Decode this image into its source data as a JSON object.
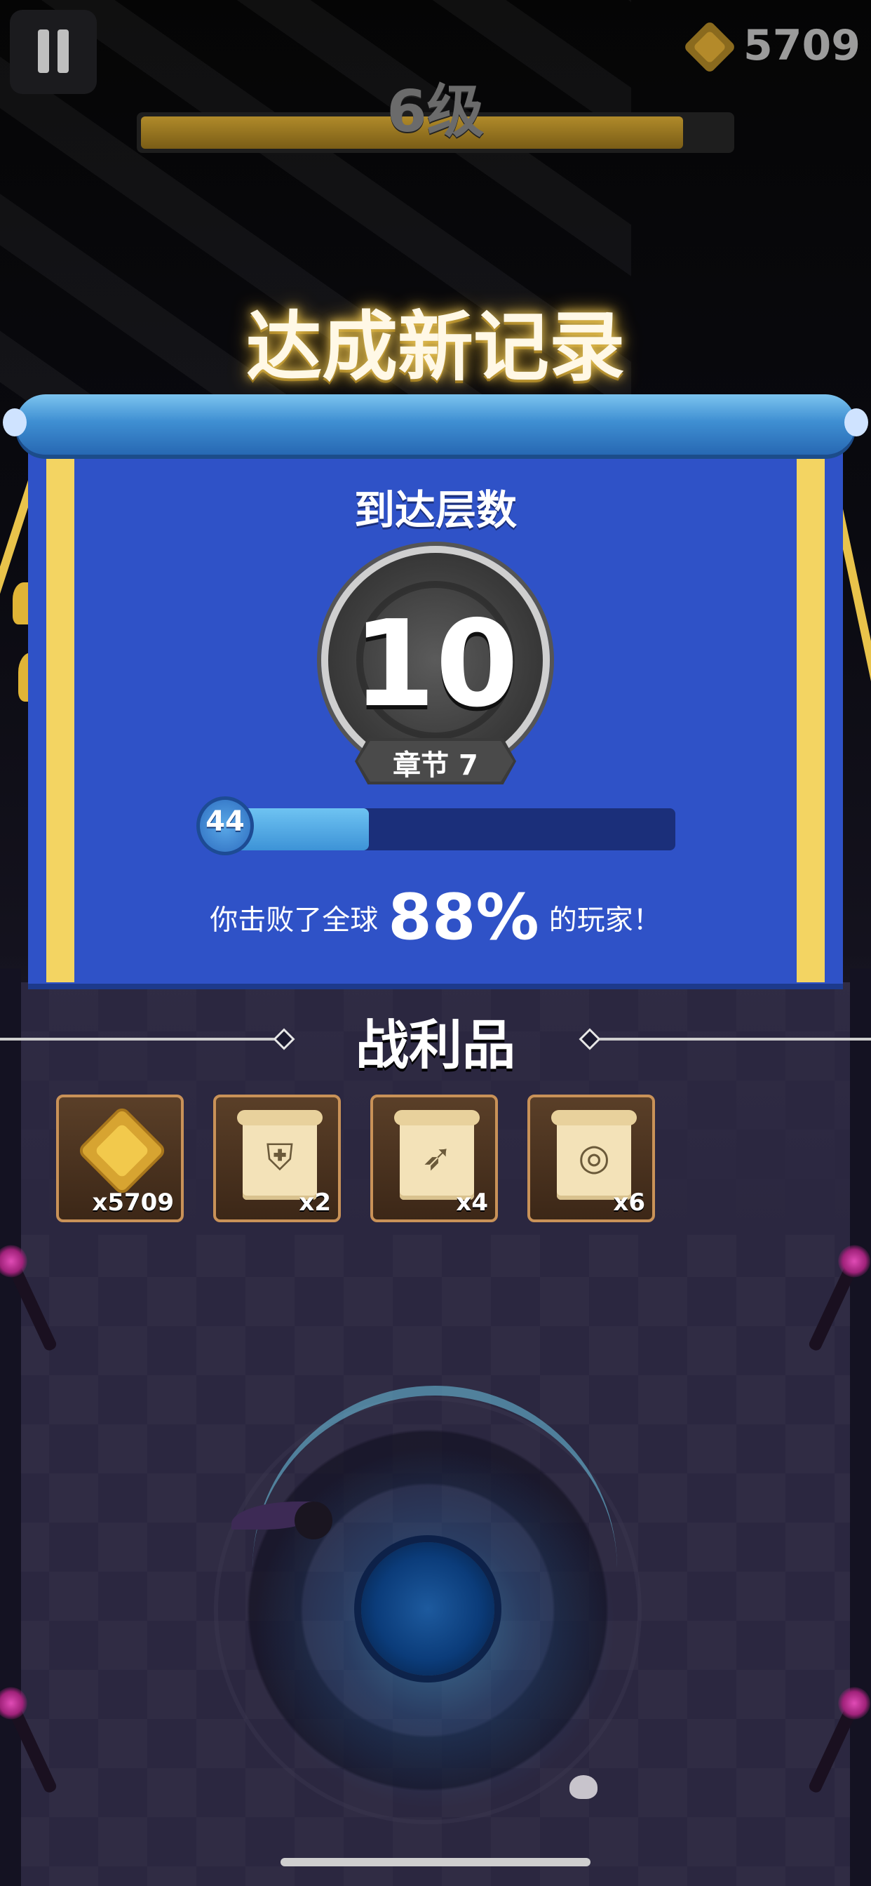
{
  "hud": {
    "currency_value": "5709",
    "level_label": "6级",
    "level_progress": 0.92
  },
  "banner": {
    "headline": "达成新记录",
    "subtitle": "到达层数",
    "floor_number": "10",
    "chapter_label": "章节 7",
    "player_level": "44",
    "xp_progress": 0.32,
    "beat_prefix": "你击败了全球",
    "beat_percent": "88%",
    "beat_suffix": "的玩家！"
  },
  "loot": {
    "title": "战利品",
    "items": [
      {
        "icon": "gem-icon",
        "qty": "x5709"
      },
      {
        "icon": "armor-scroll-icon",
        "qty": "x2",
        "glyph": "⛨"
      },
      {
        "icon": "bow-scroll-icon",
        "qty": "x4",
        "glyph": "➶"
      },
      {
        "icon": "ring-scroll-icon",
        "qty": "x6",
        "glyph": "◎"
      }
    ]
  },
  "colors": {
    "banner_blue": "#2f52c7",
    "gold": "#f3d462",
    "xp_blue": "#3d93d7"
  }
}
